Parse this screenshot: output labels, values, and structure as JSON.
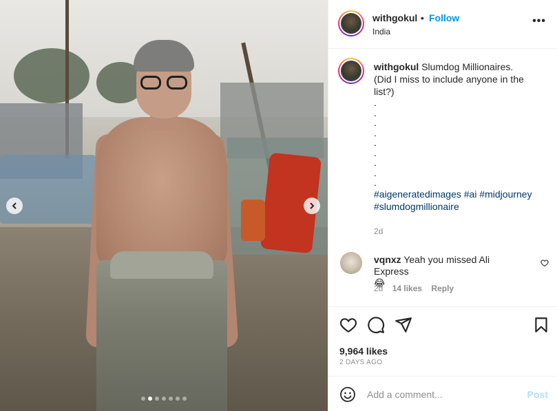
{
  "post": {
    "username": "withgokul",
    "separator": "•",
    "follow_label": "Follow",
    "location": "India",
    "more_label": "•••",
    "caption_user": "withgokul",
    "caption_text": "Slumdog Millionaires.",
    "caption_text2": "(Did I miss to include anyone in the list?)",
    "caption_dots": [
      ".",
      ".",
      ".",
      ".",
      ".",
      ".",
      ".",
      ".",
      "."
    ],
    "hashtags": "#aigeneratedimages #ai #midjourney #slumdogmillionaire",
    "caption_time": "2d",
    "likes": "9,964 likes",
    "posted_ago": "2 DAYS AGO",
    "carousel": {
      "prev_icon": "chevron-left-icon",
      "next_icon": "chevron-right-icon",
      "total": 7,
      "active_index": 1
    }
  },
  "comment": {
    "username": "vqnxz",
    "text": "Yeah you missed Ali Express",
    "emoji": "😂",
    "time": "2d",
    "likes": "14 likes",
    "reply_label": "Reply"
  },
  "composer": {
    "placeholder": "Add a comment...",
    "post_label": "Post"
  },
  "colors": {
    "accent": "#0095f6",
    "hashtag": "#00376b",
    "muted": "#8e8e8e",
    "post_disabled": "#b2dffc"
  }
}
